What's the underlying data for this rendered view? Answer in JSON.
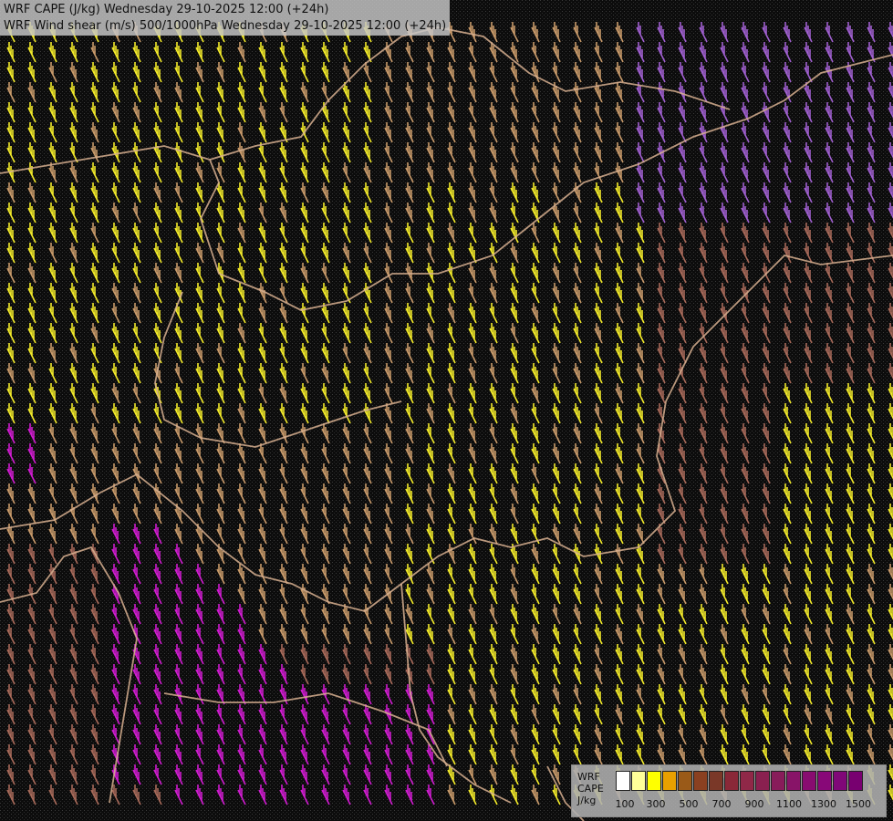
{
  "header": {
    "title_line_1": "WRF CAPE (J/kg) Wednesday 29-10-2025 12:00 (+24h)",
    "title_line_2": "WRF Wind shear (m/s) 500/1000hPa Wednesday 29-10-2025 12:00 (+24h)"
  },
  "legend": {
    "label_lines": [
      "WRF",
      "CAPE",
      "J/kg"
    ],
    "ticks": [
      "100",
      "300",
      "500",
      "700",
      "900",
      "1100",
      "1300",
      "1500"
    ],
    "colors": [
      "#ffffff",
      "#ffff99",
      "#ffff00",
      "#e8a000",
      "#9a5a18",
      "#8a4020",
      "#7a3828",
      "#8a2838",
      "#902848",
      "#8a2050",
      "#881c5a",
      "#881468",
      "#880c70",
      "#880878",
      "#800878",
      "#780070"
    ]
  },
  "map": {
    "barb_colors": {
      "yellow": "#f2ea2a",
      "tan": "#c89a6a",
      "brown": "#a86a5a",
      "pink": "#c66a6a",
      "magenta": "#d01cd0",
      "violet": "#a060d0"
    },
    "border_color": "#d8b090"
  }
}
